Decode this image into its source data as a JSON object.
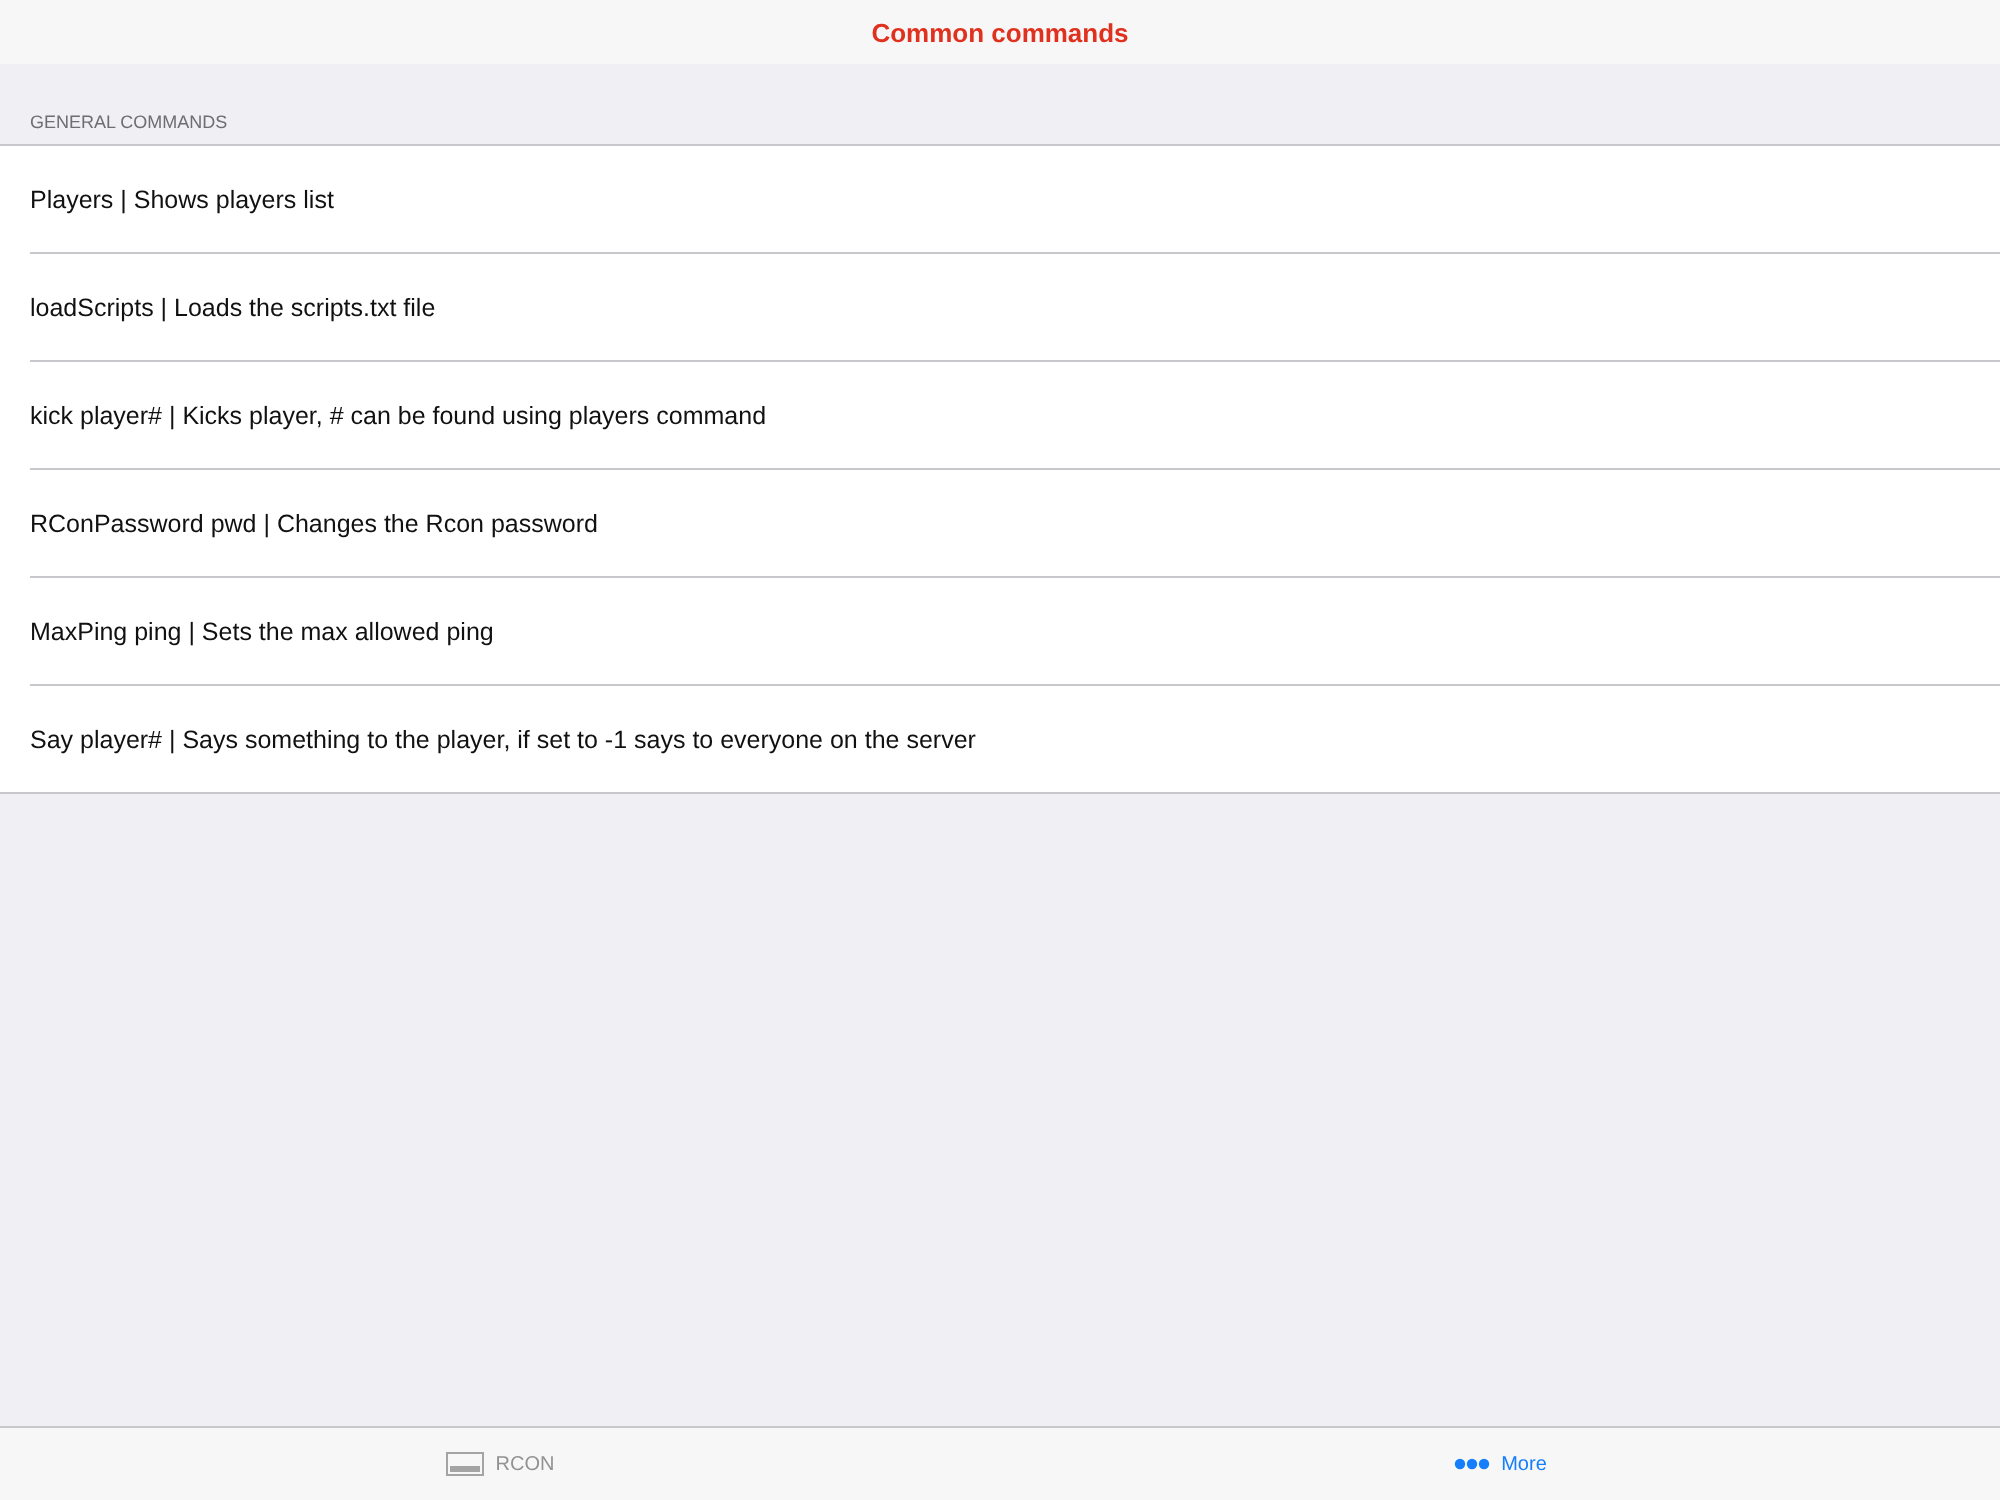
{
  "nav_bar": {
    "title": "Common commands"
  },
  "section": {
    "header": "GENERAL COMMANDS",
    "rows": [
      {
        "label": "Players | Shows players list"
      },
      {
        "label": "loadScripts | Loads the scripts.txt file"
      },
      {
        "label": "kick player# | Kicks player, # can be found using players command"
      },
      {
        "label": "RConPassword pwd | Changes the Rcon password"
      },
      {
        "label": "MaxPing ping | Sets the max allowed ping"
      },
      {
        "label": "Say player# | Says something to the player, if set to -1 says to everyone on the server"
      }
    ]
  },
  "tab_bar": [
    {
      "label": "RCON",
      "kind": "screen",
      "selected": false
    },
    {
      "label": "More",
      "kind": "more",
      "selected": true
    }
  ]
}
